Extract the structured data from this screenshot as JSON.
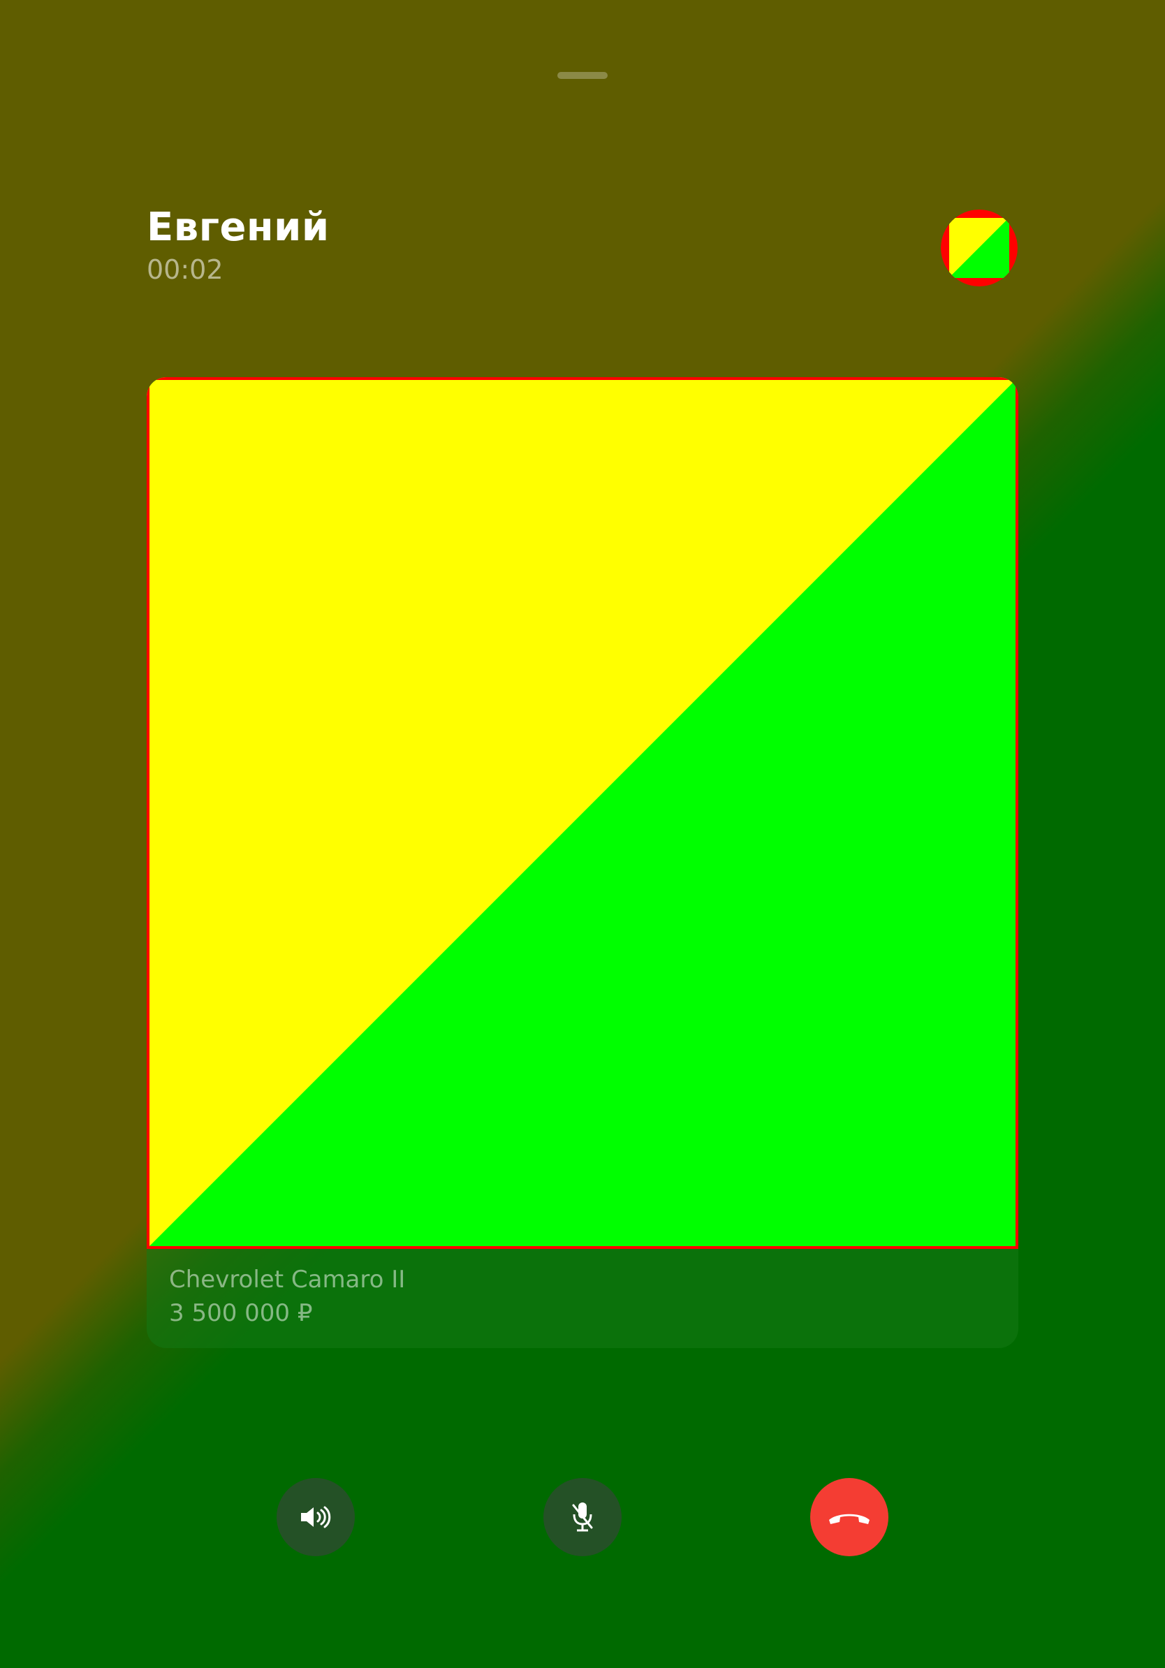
{
  "call": {
    "caller_name": "Евгений",
    "duration": "00:02"
  },
  "listing": {
    "title": "Chevrolet Camaro II",
    "price": "3 500 000 ₽"
  },
  "controls": [
    {
      "name": "speaker",
      "icon": "speaker-icon"
    },
    {
      "name": "mute",
      "icon": "mic-off-icon"
    },
    {
      "name": "end-call",
      "icon": "phone-hangup-icon"
    }
  ],
  "colors": {
    "accent_red": "#f43d33",
    "preview_yellow": "#ffff00",
    "preview_green": "#00ff00",
    "preview_border": "#ff0000"
  }
}
